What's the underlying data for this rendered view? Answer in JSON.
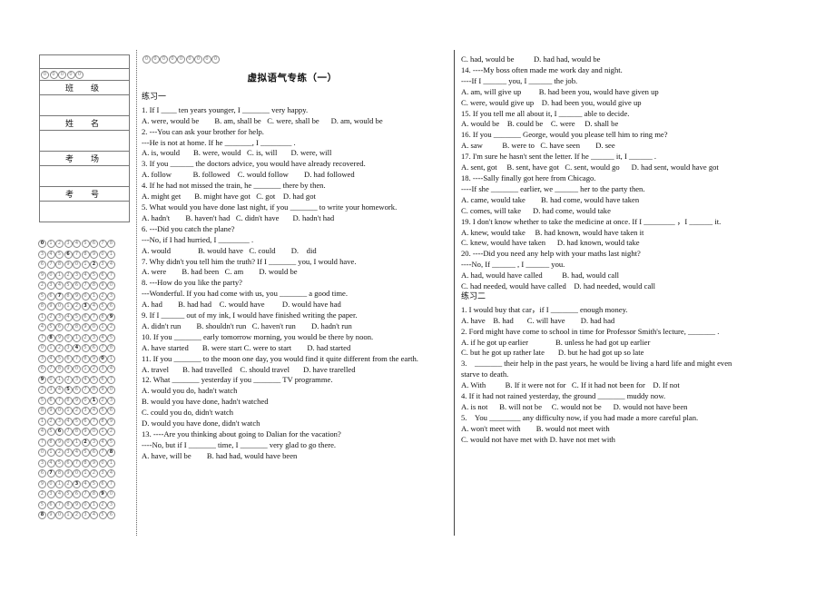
{
  "document": {
    "title": "虚拟语气专练（一）",
    "section_one": "练习一",
    "section_two": "练习二"
  },
  "answer_sheet": {
    "header_bubbles": [
      "0",
      "0",
      "0",
      "0",
      "0"
    ],
    "fields": [
      {
        "label": "班　级"
      },
      {
        "label": "姓　名"
      },
      {
        "label": "考　场"
      },
      {
        "label": "考　号"
      }
    ],
    "omr": {
      "columns": 9,
      "rows": 27,
      "bubble_letters": [
        "0",
        "1",
        "2",
        "3",
        "4",
        "5",
        "6",
        "7",
        "8",
        "9"
      ]
    }
  },
  "top_bubbles_middle": [
    "0",
    "0",
    "0",
    "0",
    "0",
    "0",
    "0",
    "0",
    "0"
  ],
  "middle_column": {
    "lines": [
      "1. If I ____ ten years younger, I _______ very happy.",
      "A. were, would be        B. am, shall be   C. were, shall be      D. am, would be",
      "2. ---You can ask your brother for help.",
      "---He is not at home. If he _______, I ________ .",
      "A. is, would       B. were, would   C. is, will       D. were, will",
      "3. If you ______ the doctors advice, you would have already recovered.",
      "A. follow           B. followed    C. would follow        D. had followed",
      "4. If he had not missed the train, he _______ there by then.",
      "A. might get       B. might have got   C. got    D. had got",
      "5. What would you have done last night, if you _______ to write your homework.",
      "A. hadn't        B. haven't had   C. didn't have       D. hadn't had",
      "6. ---Did you catch the plane?",
      "---No, if I had hurried, I ________ .",
      "A. would              B. would have   C. could        D.　did",
      "7. Why didn't you tell him the truth? If I _______ you, I would have.",
      "A. were        B. had been   C. am        D. would be",
      "8. ---How do you like the party?",
      "---Wonderful. If you had come with us, you _______ a good time.",
      "A. had        B. had had    C. would have         D. would have had",
      "9. If I ______ out of my ink, I would have finished writing the paper.",
      "A. didn't run        B. shouldn't run   C. haven't run        D. hadn't run",
      "10. If you _______ early tomorrow morning, you would be there by noon.",
      "A. have started       B. were start C. were to start        D. had started",
      "11. If you _______ to the moon one day, you would find it quite different from the earth.",
      "A. travel       B. had travelled    C. should travel       D. have trarelled",
      "12. What _______ yesterday if you _______ TV programme.",
      "A. would you do, hadn't watch",
      "B. would you have done, hadn't watched",
      "C. could you do, didn't watch",
      "D. would you have done, didn't watch",
      "13. ----Are you thinking about going to Dalian for the vacation?",
      "----No, but if I _______ time, I _______ very glad to go there.",
      "A. have, will be        B. had had, would have been"
    ]
  },
  "right_column": {
    "lines_before_section_two": [
      "C. had, would be          D. had had, would be",
      "14. ----My boss often made me work day and night.",
      "----If I ______ you, I ______ the job.",
      "A. am, will give up         B. had been you, would have given up",
      "C. were, would give up    D. had been you, would give up",
      "15. If you tell me all about it, I ______ able to decide.",
      "A. would be    B. could be    C. were     D. shall be",
      "16. If you _______ George, would you please tell him to ring me?",
      "A. saw          B. were to   C. have seen        D. see",
      "17. I'm sure he hasn't sent the letter. If he ______ it, I ______ .",
      "A. sent, got     B. sent, have got   C. sent, would go      D. had sent, would have got",
      "18. ----Sally finally got here from Chicago.",
      "----If she _______ earlier, we ______ her to the party then.",
      "A. came, would take        B. had come, would have taken",
      "C. comes, will take      D. had come, would take",
      "19. I don't know whether to take the medicine at once. If I ________ ，I ______ it.",
      "A. knew, would take     B. had known, would have taken it",
      "C. knew, would have taken      D. had known, would take",
      "20. ----Did you need any help with your maths last night?",
      "----No, If ______ , I ______ you.",
      "A. had, would have called          B. had, would call",
      "C. had needed, would have called    D. had needed, would call"
    ],
    "lines_after_section_two": [
      "1. I would buy that car，if I _______ enough money.",
      "A. have    B. had       C. will have        D. had had",
      "2. Ford might have come to school in time for Professor Smith's lecture, _______ .",
      "A. if he got up earlier              B. unless he had got up earlier",
      "C. but he got up rather late       D. but he had got up so late",
      "3.    _______ their help in the past years, he would be living a hard life and might even",
      "starve to death.",
      "A. With          B. If it were not for   C. If it had not been for    D. If not",
      "4. If it had not rained yesterday, the ground _______ muddy now.",
      "A. is not      B. will not be     C. would not be      D. would not have been",
      "5.　You ________ any difficulty now, if you had made a more careful plan.",
      "A. won't meet with        B. would not meet with",
      "C. would not have met with D. have not met with"
    ]
  }
}
